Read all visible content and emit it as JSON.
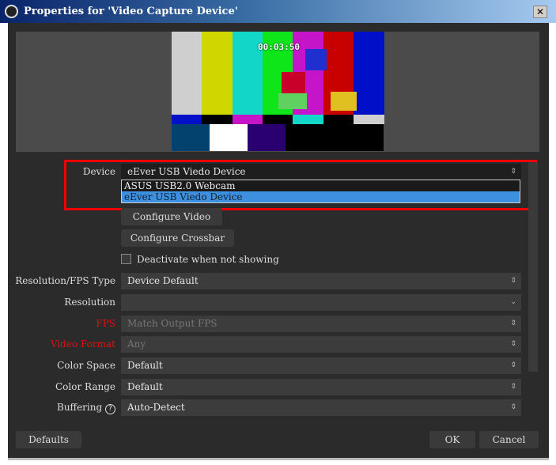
{
  "window": {
    "title": "Properties for 'Video Capture Device'",
    "close_label": "✕"
  },
  "preview": {
    "timestamp": "00:03:50"
  },
  "device": {
    "label": "Device",
    "value": "eEver USB Viedo Device",
    "options": [
      "ASUS USB2.0 Webcam",
      "eEver USB Viedo Device"
    ],
    "selected_index": 1
  },
  "buttons": {
    "configure_video": "Configure Video",
    "configure_crossbar": "Configure Crossbar",
    "defaults": "Defaults",
    "ok": "OK",
    "cancel": "Cancel"
  },
  "checkbox": {
    "label": "Deactivate when not showing",
    "checked": false
  },
  "rows": [
    {
      "label": "Resolution/FPS Type",
      "value": "Device Default",
      "arrow": "⇕"
    },
    {
      "label": "Resolution",
      "value": "",
      "arrow": "⌄"
    },
    {
      "label": "FPS",
      "value": "Match Output FPS",
      "arrow": "⇕"
    },
    {
      "label": "Video Format",
      "value": "Any",
      "arrow": "⇕"
    },
    {
      "label": "Color Space",
      "value": "Default",
      "arrow": "⇕"
    },
    {
      "label": "Color Range",
      "value": "Default",
      "arrow": "⇕"
    },
    {
      "label": "Buffering",
      "value": "Auto-Detect",
      "arrow": "⇕"
    }
  ],
  "help_icon": "?",
  "colors": {
    "highlight": "#e00000",
    "selection": "#3d8fe0"
  }
}
